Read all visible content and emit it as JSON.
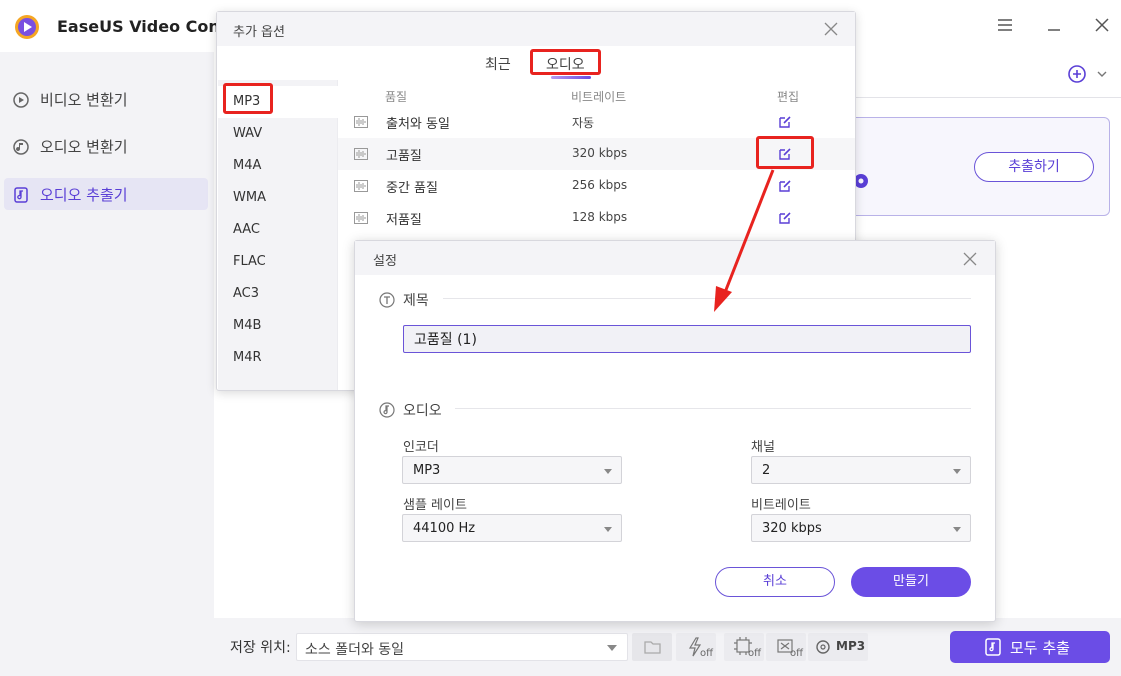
{
  "app": {
    "title": "EaseUS Video Conver",
    "window_controls": [
      "menu-icon",
      "minimize-icon",
      "close-icon"
    ]
  },
  "sidebar": {
    "items": [
      {
        "label": "비디오 변환기",
        "icon": "video-convert-icon",
        "active": false
      },
      {
        "label": "오디오 변환기",
        "icon": "audio-convert-icon",
        "active": false
      },
      {
        "label": "오디오 추출기",
        "icon": "audio-extract-icon",
        "active": true
      }
    ]
  },
  "main": {
    "extract_button": "추출하기"
  },
  "bottom": {
    "save_label": "저장 위치:",
    "save_path": "소스 폴더와 동일",
    "tools": [
      {
        "icon": "speed-icon",
        "state": "off"
      },
      {
        "icon": "hardware-accel-icon",
        "state": "off"
      },
      {
        "icon": "gpu-icon",
        "state": "off"
      }
    ],
    "format_badge": "MP3",
    "extract_all": "모두 추출"
  },
  "options_dialog": {
    "title": "추가 옵션",
    "tabs": [
      {
        "label": "최근",
        "active": false
      },
      {
        "label": "오디오",
        "active": true
      }
    ],
    "formats": [
      "MP3",
      "WAV",
      "M4A",
      "WMA",
      "AAC",
      "FLAC",
      "AC3",
      "M4B",
      "M4R"
    ],
    "selected_format": "MP3",
    "columns": {
      "quality": "품질",
      "bitrate": "비트레이트",
      "edit": "편집"
    },
    "rows": [
      {
        "quality": "출처와 동일",
        "bitrate": "자동"
      },
      {
        "quality": "고품질",
        "bitrate": "320 kbps"
      },
      {
        "quality": "중간 품질",
        "bitrate": "256 kbps"
      },
      {
        "quality": "저품질",
        "bitrate": "128 kbps"
      }
    ]
  },
  "settings_dialog": {
    "title": "설정",
    "section_title": "제목",
    "name_value": "고품질 (1)",
    "section_audio": "오디오",
    "encoder_label": "인코더",
    "encoder_value": "MP3",
    "channel_label": "채널",
    "channel_value": "2",
    "samplerate_label": "샘플 레이트",
    "samplerate_value": "44100 Hz",
    "bitrate_label": "비트레이트",
    "bitrate_value": "320 kbps",
    "cancel": "취소",
    "create": "만들기"
  },
  "colors": {
    "accent": "#6b4de6",
    "annotation": "#e8231f",
    "sidebar_bg": "#f3f3f6"
  }
}
